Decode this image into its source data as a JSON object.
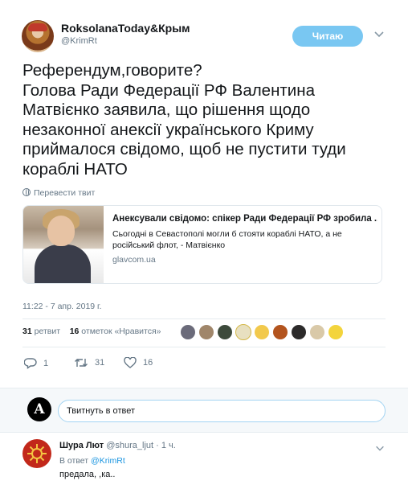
{
  "header": {
    "display_name": "RoksolanaToday&Крым",
    "handle": "@KrimRt",
    "follow_label": "Читаю"
  },
  "tweet": {
    "text": "Референдум,говорите?\nГолова Ради Федерації РФ Валентина Матвієнко заявила, що рішення щодо незаконної анексії українського Криму приймалося свідомо, щоб не пустити туди кораблі НАТО",
    "translate_label": "Перевести твит",
    "timestamp": "11:22 - 7 апр. 2019 г."
  },
  "card": {
    "title": "Анексували свідомо: спікер Ради Федерації РФ зробила ...",
    "description": "Сьогодні в Севастополі могли б стояти кораблі НАТО, а не російський флот, - Матвієнко",
    "domain": "glavcom.ua"
  },
  "stats": {
    "retweets_count": "31",
    "retweets_label": "ретвит",
    "likes_count": "16",
    "likes_label": "отметок «Нравится»"
  },
  "actions": {
    "reply_count": "1",
    "retweet_count": "31",
    "like_count": "16"
  },
  "reply_box": {
    "avatar_letter": "A",
    "placeholder": "Твитнуть в ответ"
  },
  "reply": {
    "name": "Шура Лют",
    "handle": "@shura_ljut",
    "time": "· 1 ч.",
    "in_reply_prefix": "В ответ",
    "in_reply_handle": "@KrimRt",
    "text": "предала, ,ка.."
  },
  "colors": {
    "accent": "#1b95e0",
    "follow_button": "#79c7f2",
    "secondary_text": "#657786",
    "like_pink": "#e0245e"
  },
  "icons": [
    "globe-icon",
    "chevron-down-icon",
    "reply-icon",
    "retweet-icon",
    "like-icon"
  ]
}
